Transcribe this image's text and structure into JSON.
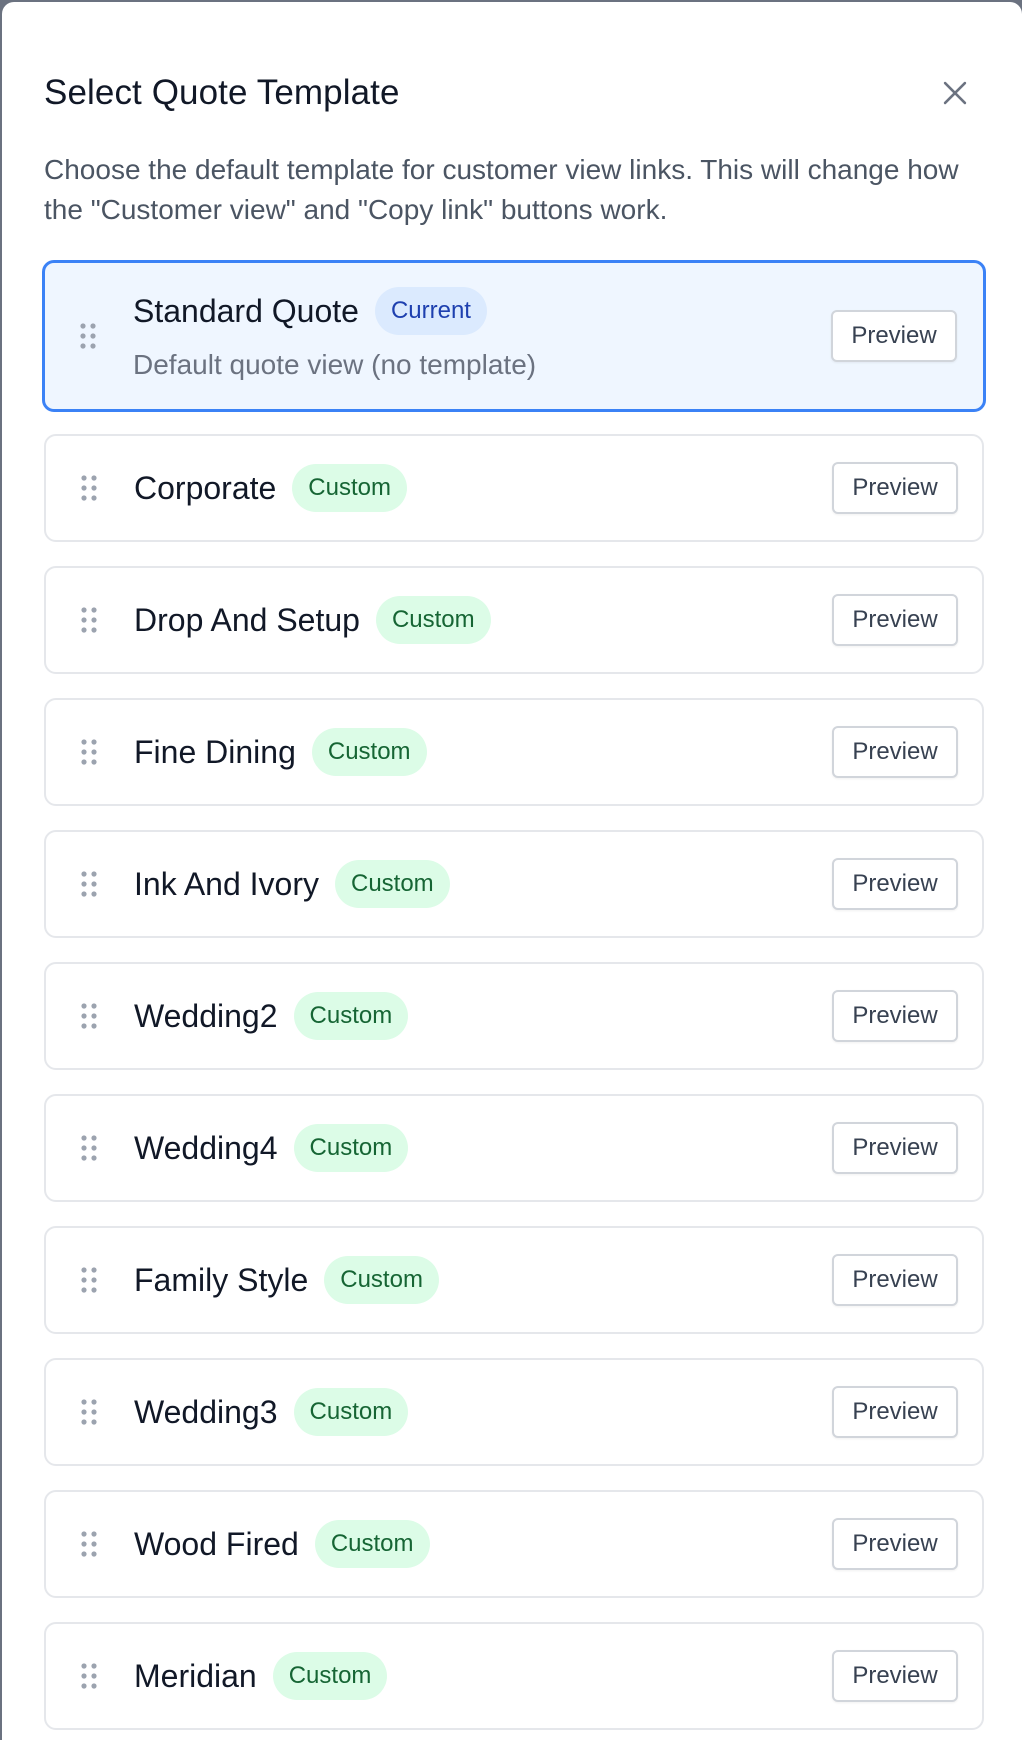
{
  "dialog": {
    "title": "Select Quote Template",
    "description": "Choose the default template for customer view links. This will change how the \"Customer view\" and \"Copy link\" buttons work.",
    "close_icon": "close-icon"
  },
  "colors": {
    "selected_border": "#3b82f6",
    "selected_background": "#eff6ff",
    "current_badge_bg": "#dbeafe",
    "current_badge_text": "#1e40af",
    "custom_badge_bg": "#dcfce7",
    "custom_badge_text": "#166534"
  },
  "templates": [
    {
      "name": "Standard Quote",
      "badge": "Current",
      "badge_type": "current",
      "description": "Default quote view (no template)",
      "selected": true,
      "preview_label": "Preview"
    },
    {
      "name": "Corporate",
      "badge": "Custom",
      "badge_type": "custom",
      "preview_label": "Preview"
    },
    {
      "name": "Drop And Setup",
      "badge": "Custom",
      "badge_type": "custom",
      "preview_label": "Preview"
    },
    {
      "name": "Fine Dining",
      "badge": "Custom",
      "badge_type": "custom",
      "preview_label": "Preview"
    },
    {
      "name": "Ink And Ivory",
      "badge": "Custom",
      "badge_type": "custom",
      "preview_label": "Preview"
    },
    {
      "name": "Wedding2",
      "badge": "Custom",
      "badge_type": "custom",
      "preview_label": "Preview"
    },
    {
      "name": "Wedding4",
      "badge": "Custom",
      "badge_type": "custom",
      "preview_label": "Preview"
    },
    {
      "name": "Family Style",
      "badge": "Custom",
      "badge_type": "custom",
      "preview_label": "Preview"
    },
    {
      "name": "Wedding3",
      "badge": "Custom",
      "badge_type": "custom",
      "preview_label": "Preview"
    },
    {
      "name": "Wood Fired",
      "badge": "Custom",
      "badge_type": "custom",
      "preview_label": "Preview"
    },
    {
      "name": "Meridian",
      "badge": "Custom",
      "badge_type": "custom",
      "preview_label": "Preview"
    }
  ]
}
